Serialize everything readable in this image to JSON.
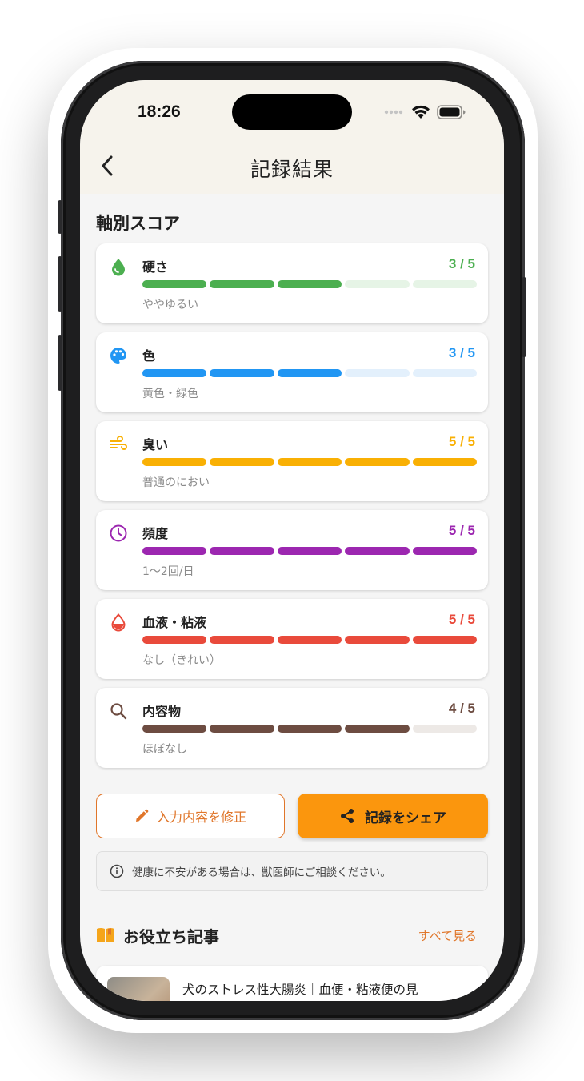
{
  "status_bar": {
    "time": "18:26"
  },
  "header": {
    "title": "記録結果"
  },
  "section": {
    "title": "軸別スコア"
  },
  "scores": [
    {
      "icon": "water-drop-icon",
      "label": "硬さ",
      "score_text": "3 / 5",
      "value": 3,
      "max": 5,
      "description": "ややゆるい",
      "color": "#4caf50",
      "track": "#e6f4e6"
    },
    {
      "icon": "palette-icon",
      "label": "色",
      "score_text": "3 / 5",
      "value": 3,
      "max": 5,
      "description": "黄色・緑色",
      "color": "#2196f3",
      "track": "#e3f0fc"
    },
    {
      "icon": "wind-icon",
      "label": "臭い",
      "score_text": "5 / 5",
      "value": 5,
      "max": 5,
      "description": "普通のにおい",
      "color": "#f9b004",
      "track": "#fdf1d3"
    },
    {
      "icon": "clock-icon",
      "label": "頻度",
      "score_text": "5 / 5",
      "value": 5,
      "max": 5,
      "description": "1〜2回/日",
      "color": "#9c27b0",
      "track": "#f2e3f5"
    },
    {
      "icon": "blood-drop-icon",
      "label": "血液・粘液",
      "score_text": "5 / 5",
      "value": 5,
      "max": 5,
      "description": "なし（きれい）",
      "color": "#e94a3b",
      "track": "#fbe2e0"
    },
    {
      "icon": "search-icon",
      "label": "内容物",
      "score_text": "4 / 5",
      "value": 4,
      "max": 5,
      "description": "ほぼなし",
      "color": "#6d4c41",
      "track": "#ede9e6"
    }
  ],
  "actions": {
    "edit_label": "入力内容を修正",
    "share_label": "記録をシェア"
  },
  "notice": {
    "text": "健康に不安がある場合は、獣医師にご相談ください。"
  },
  "articles": {
    "title": "お役立ち記事",
    "see_all": "すべて見る",
    "items": [
      {
        "title": "犬のストレス性大腸炎｜血便・粘液便の見"
      }
    ]
  },
  "colors": {
    "accent": "#fb960d",
    "accent_text": "#e0762a",
    "header_bg": "#f6f3ec"
  }
}
